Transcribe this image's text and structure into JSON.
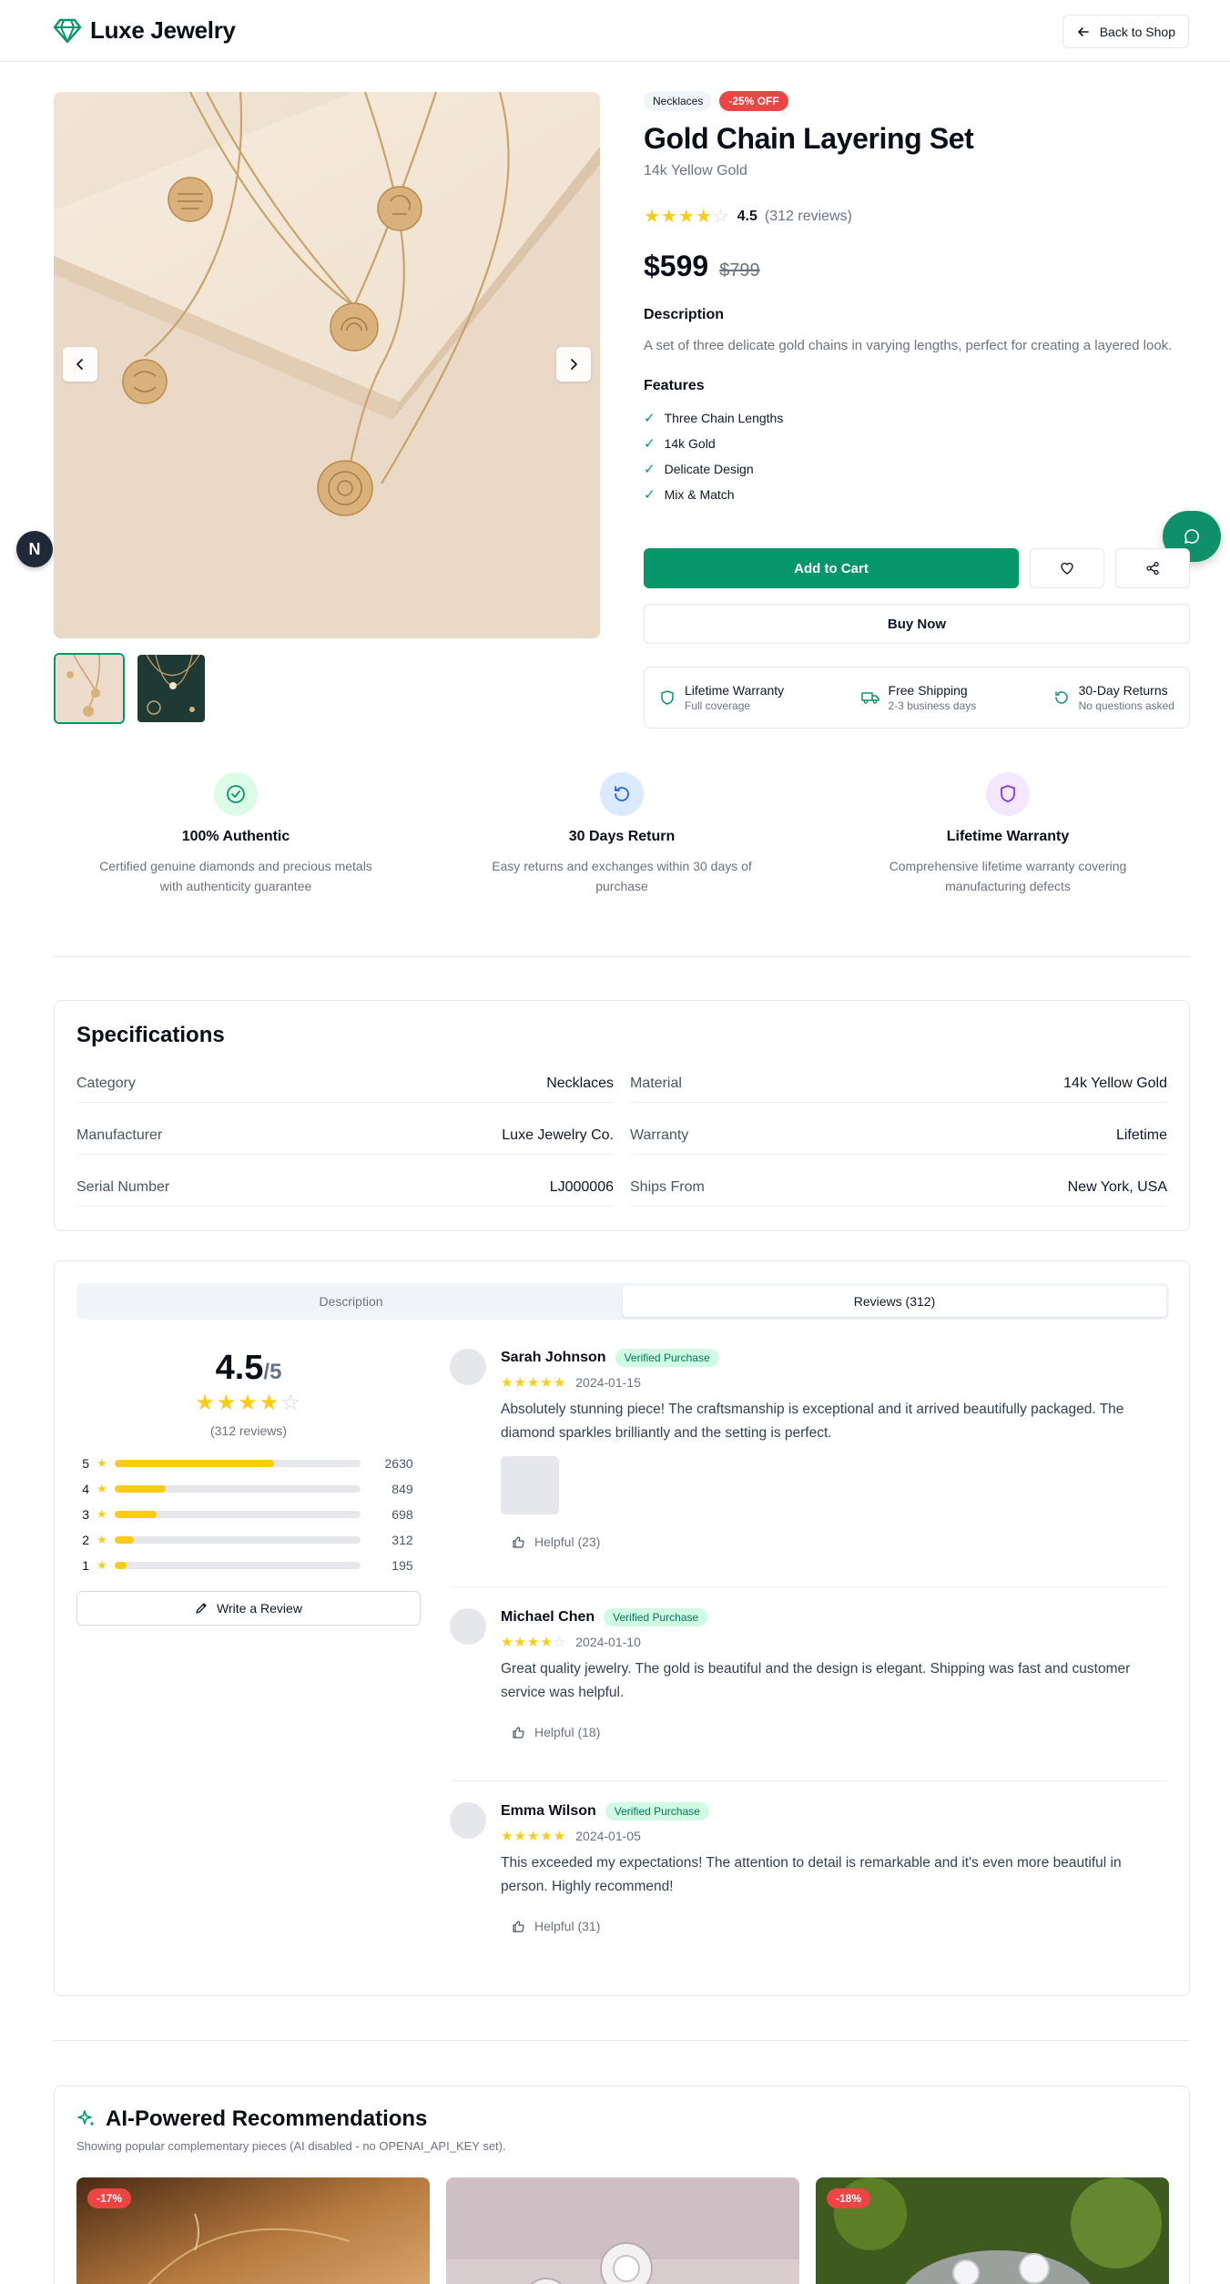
{
  "header": {
    "brand": "Luxe Jewelry",
    "back_label": "Back to Shop"
  },
  "gallery": {
    "floating_badge": "N"
  },
  "product": {
    "category_tag": "Necklaces",
    "discount_tag": "-25% OFF",
    "title": "Gold Chain Layering Set",
    "material": "14k Yellow Gold",
    "rating": "4.5",
    "rating_count": "(312 reviews)",
    "price": "$599",
    "old_price": "$799",
    "description_label": "Description",
    "description": "A set of three delicate gold chains in varying lengths, perfect for creating a layered look.",
    "features_label": "Features",
    "features": [
      "Three Chain Lengths",
      "14k Gold",
      "Delicate Design",
      "Mix & Match"
    ],
    "add_to_cart": "Add to Cart",
    "buy_now": "Buy Now"
  },
  "perks": [
    {
      "title": "Lifetime Warranty",
      "sub": "Full coverage"
    },
    {
      "title": "Free Shipping",
      "sub": "2-3 business days"
    },
    {
      "title": "30-Day Returns",
      "sub": "No questions asked"
    }
  ],
  "trust": [
    {
      "title": "100% Authentic",
      "desc": "Certified genuine diamonds and precious metals with authenticity guarantee"
    },
    {
      "title": "30 Days Return",
      "desc": "Easy returns and exchanges within 30 days of purchase"
    },
    {
      "title": "Lifetime Warranty",
      "desc": "Comprehensive lifetime warranty covering manufacturing defects"
    }
  ],
  "specs": {
    "title": "Specifications",
    "rows": [
      {
        "k": "Category",
        "v": "Necklaces"
      },
      {
        "k": "Material",
        "v": "14k Yellow Gold"
      },
      {
        "k": "Manufacturer",
        "v": "Luxe Jewelry Co."
      },
      {
        "k": "Warranty",
        "v": "Lifetime"
      },
      {
        "k": "Serial Number",
        "v": "LJ000006"
      },
      {
        "k": "Ships From",
        "v": "New York, USA"
      }
    ]
  },
  "reviews": {
    "tabs": [
      "Description",
      "Reviews (312)"
    ],
    "average": "4.5",
    "out_of": "/5",
    "count": "(312 reviews)",
    "distribution": [
      {
        "stars": "5",
        "count": "2630",
        "fraction": 0.65
      },
      {
        "stars": "4",
        "count": "849",
        "fraction": 0.21
      },
      {
        "stars": "3",
        "count": "698",
        "fraction": 0.17
      },
      {
        "stars": "2",
        "count": "312",
        "fraction": 0.08
      },
      {
        "stars": "1",
        "count": "195",
        "fraction": 0.05
      }
    ],
    "write_label": "Write a Review",
    "items": [
      {
        "name": "Sarah Johnson",
        "badge": "Verified Purchase",
        "stars": 5,
        "date": "2024-01-15",
        "text": "Absolutely stunning piece! The craftsmanship is exceptional and it arrived beautifully packaged. The diamond sparkles brilliantly and the setting is perfect.",
        "helpful": "Helpful (23)"
      },
      {
        "name": "Michael Chen",
        "badge": "Verified Purchase",
        "stars": 4,
        "date": "2024-01-10",
        "text": "Great quality jewelry. The gold is beautiful and the design is elegant. Shipping was fast and customer service was helpful.",
        "helpful": "Helpful (18)"
      },
      {
        "name": "Emma Wilson",
        "badge": "Verified Purchase",
        "stars": 5,
        "date": "2024-01-05",
        "text": "This exceeded my expectations! The attention to detail is remarkable and it's even more beautiful in person. Highly recommend!",
        "helpful": "Helpful (31)"
      }
    ]
  },
  "recommendations": {
    "title": "AI-Powered Recommendations",
    "subtitle": "Showing popular complementary pieces (AI disabled - no OPENAI_API_KEY set).",
    "items": [
      {
        "badge": "-17%"
      },
      {
        "badge": ""
      },
      {
        "badge": "-18%"
      }
    ]
  },
  "colors": {
    "accent": "#059669",
    "sale": "#ef4444",
    "star": "#facc15"
  }
}
